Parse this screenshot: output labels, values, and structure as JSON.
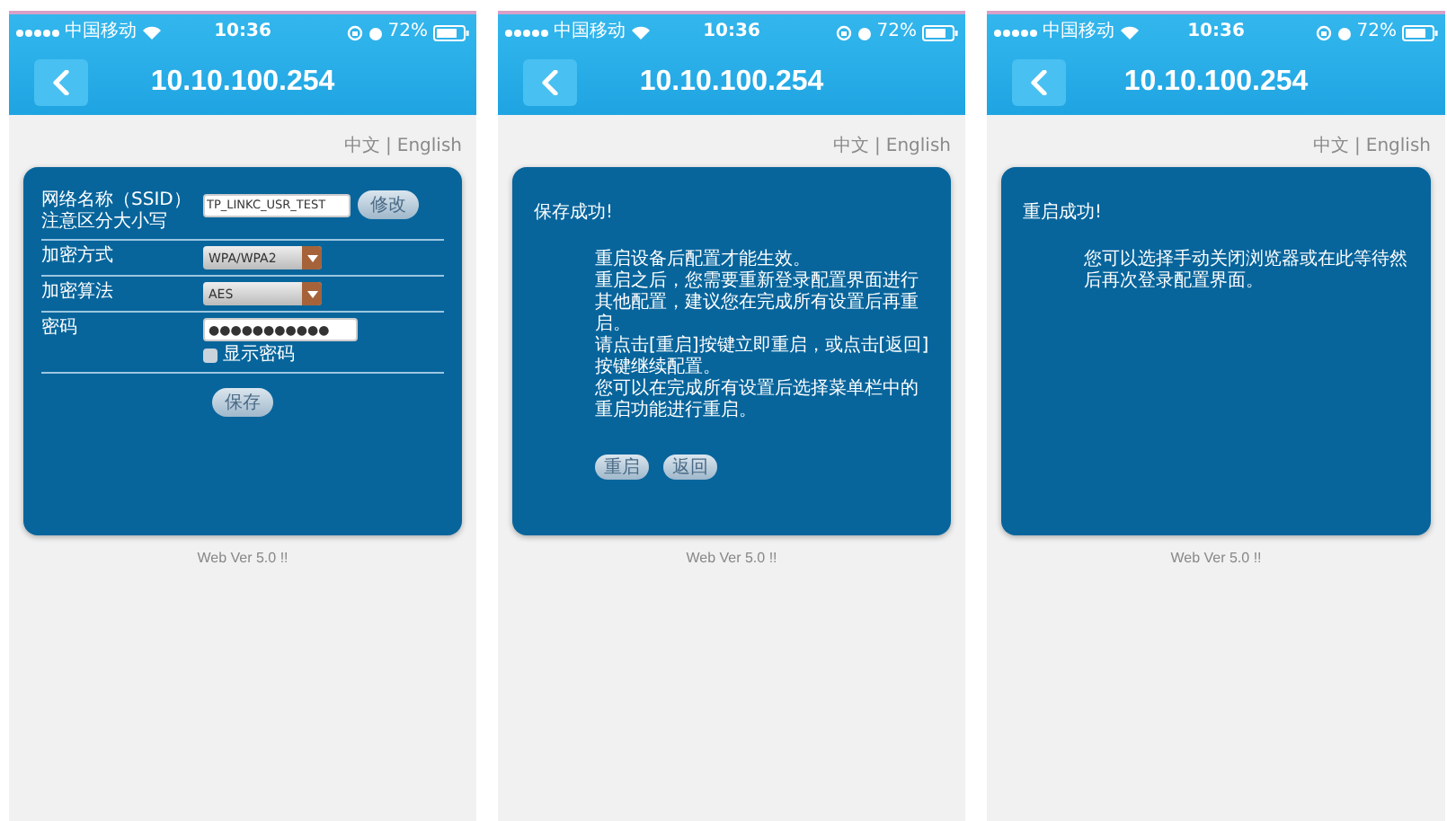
{
  "phones": [
    {
      "status": {
        "carrier": "中国移动",
        "time": "10:36",
        "battery": "72%"
      },
      "title": "10.10.100.254",
      "lang": {
        "items": [
          "中文",
          "English"
        ],
        "separator": "|"
      },
      "card": {
        "kind": "form",
        "fields": [
          {
            "kind": "text",
            "label": "网络名称（SSID）",
            "hint": "注意区分大小写",
            "value": "TP_LINKC_USR_TEST",
            "button": "修改"
          },
          {
            "kind": "select",
            "label": "加密方式",
            "value": "WPA/WPA2"
          },
          {
            "kind": "select",
            "label": "加密算法",
            "value": "AES"
          },
          {
            "kind": "password",
            "label": "密码",
            "value": "●●●●●●●●●●●",
            "show_label": "显示密码",
            "checked": false
          }
        ],
        "submit": "保存"
      },
      "footer": "Web Ver 5.0 !!"
    },
    {
      "status": {
        "carrier": "中国移动",
        "time": "10:36",
        "battery": "72%"
      },
      "title": "10.10.100.254",
      "lang": {
        "items": [
          "中文",
          "English"
        ],
        "separator": "|"
      },
      "card": {
        "kind": "notice",
        "heading": "保存成功!",
        "paragraphs": [
          "重启设备后配置才能生效。",
          "重启之后，您需要重新登录配置界面进行其他配置，建议您在完成所有设置后再重启。",
          "请点击[重启]按键立即重启，或点击[返回]按键继续配置。",
          "您可以在完成所有设置后选择菜单栏中的重启功能进行重启。"
        ],
        "buttons": [
          "重启",
          "返回"
        ]
      },
      "footer": "Web Ver 5.0 !!"
    },
    {
      "status": {
        "carrier": "中国移动",
        "time": "10:36",
        "battery": "72%"
      },
      "title": "10.10.100.254",
      "lang": {
        "items": [
          "中文",
          "English"
        ],
        "separator": "|"
      },
      "card": {
        "kind": "notice",
        "heading": "重启成功!",
        "paragraphs": [
          "您可以选择手动关闭浏览器或在此等待然后再次登录配置界面。"
        ]
      },
      "footer": "Web Ver 5.0 !!"
    }
  ]
}
